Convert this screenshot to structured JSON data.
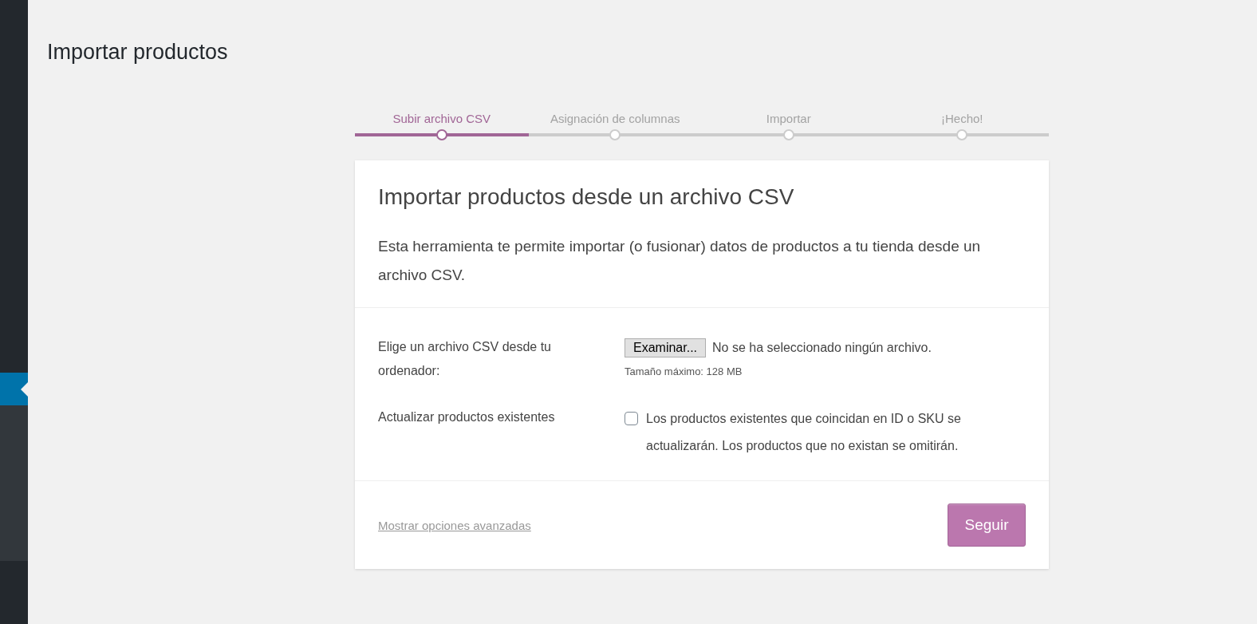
{
  "page_title": "Importar productos",
  "steps": [
    {
      "label": "Subir archivo CSV",
      "selected": true
    },
    {
      "label": "Asignación de columnas",
      "selected": false
    },
    {
      "label": "Importar",
      "selected": false
    },
    {
      "label": "¡Hecho!",
      "selected": false
    }
  ],
  "card": {
    "title": "Importar productos desde un archivo CSV",
    "description": "Esta herramienta te permite importar (o fusionar) datos de productos a tu tienda desde un archivo CSV.",
    "fields": [
      {
        "kind": "file",
        "label": "Elige un archivo CSV desde tu ordenador:",
        "button": "Examinar...",
        "value": "No se ha seleccionado ningún archivo.",
        "hint": "Tamaño máximo: 128 MB"
      },
      {
        "kind": "checkbox",
        "label": "Actualizar productos existentes",
        "checked": false,
        "text": "Los productos existentes que coincidan en ID o SKU se actualizarán. Los productos que no existan se omitirán."
      }
    ],
    "advanced_link": "Mostrar opciones avanzadas",
    "submit": "Seguir"
  }
}
